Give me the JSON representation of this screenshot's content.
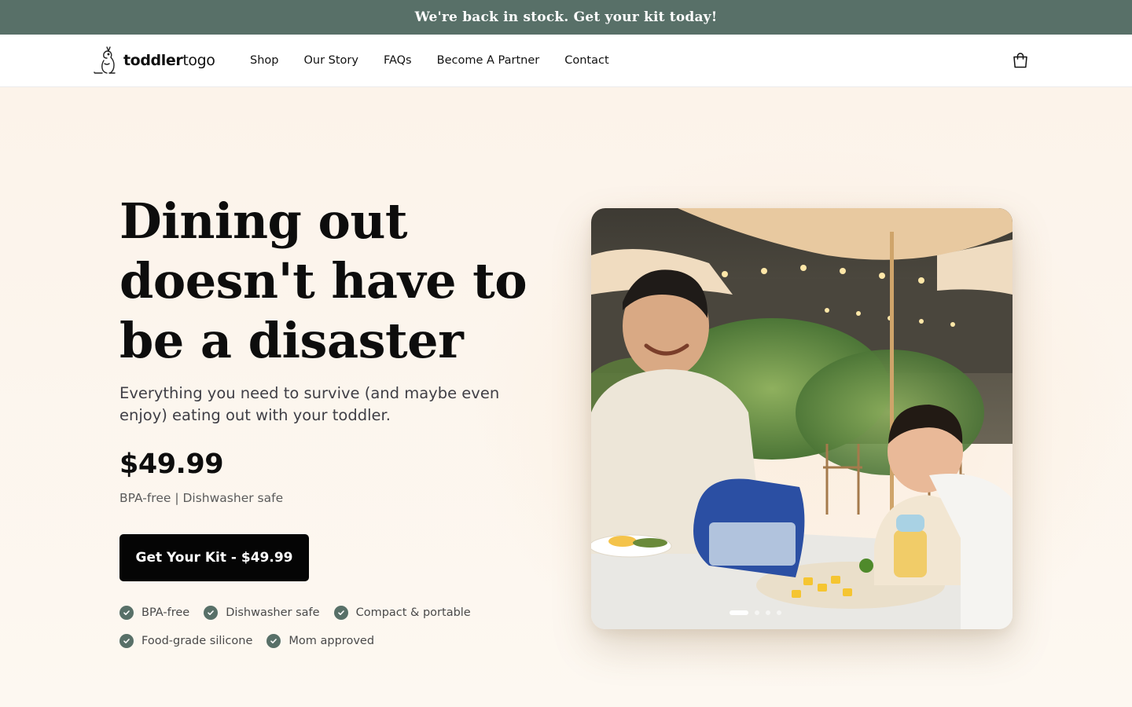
{
  "announcement": {
    "text": "We're back in stock. Get your kit today!"
  },
  "brand": {
    "name_bold": "toddler",
    "name_light": "togo",
    "logo_icon": "kangaroo-icon"
  },
  "nav": {
    "items": [
      {
        "label": "Shop"
      },
      {
        "label": "Our Story"
      },
      {
        "label": "FAQs"
      },
      {
        "label": "Become A Partner"
      },
      {
        "label": "Contact"
      }
    ],
    "cart_icon": "shopping-bag-icon"
  },
  "hero": {
    "headline": "Dining out doesn't have to be a disaster",
    "subheadline": "Everything you need to survive (and maybe even enjoy) eating out with your toddler.",
    "price": "$49.99",
    "price_note": "BPA-free | Dishwasher safe",
    "cta_label": "Get Your Kit - $49.99",
    "features": [
      {
        "label": "BPA-free"
      },
      {
        "label": "Dishwasher safe"
      },
      {
        "label": "Compact & portable"
      },
      {
        "label": "Food-grade silicone"
      },
      {
        "label": "Mom approved"
      }
    ],
    "image": {
      "subject": "father-and-toddler-dining-outdoors",
      "carousel_slides": 4,
      "active_slide": 1
    }
  },
  "colors": {
    "announcement_bg": "#587068",
    "page_bg": "#fdf8f1",
    "cta_bg": "#050505",
    "check_bg": "#587068"
  }
}
